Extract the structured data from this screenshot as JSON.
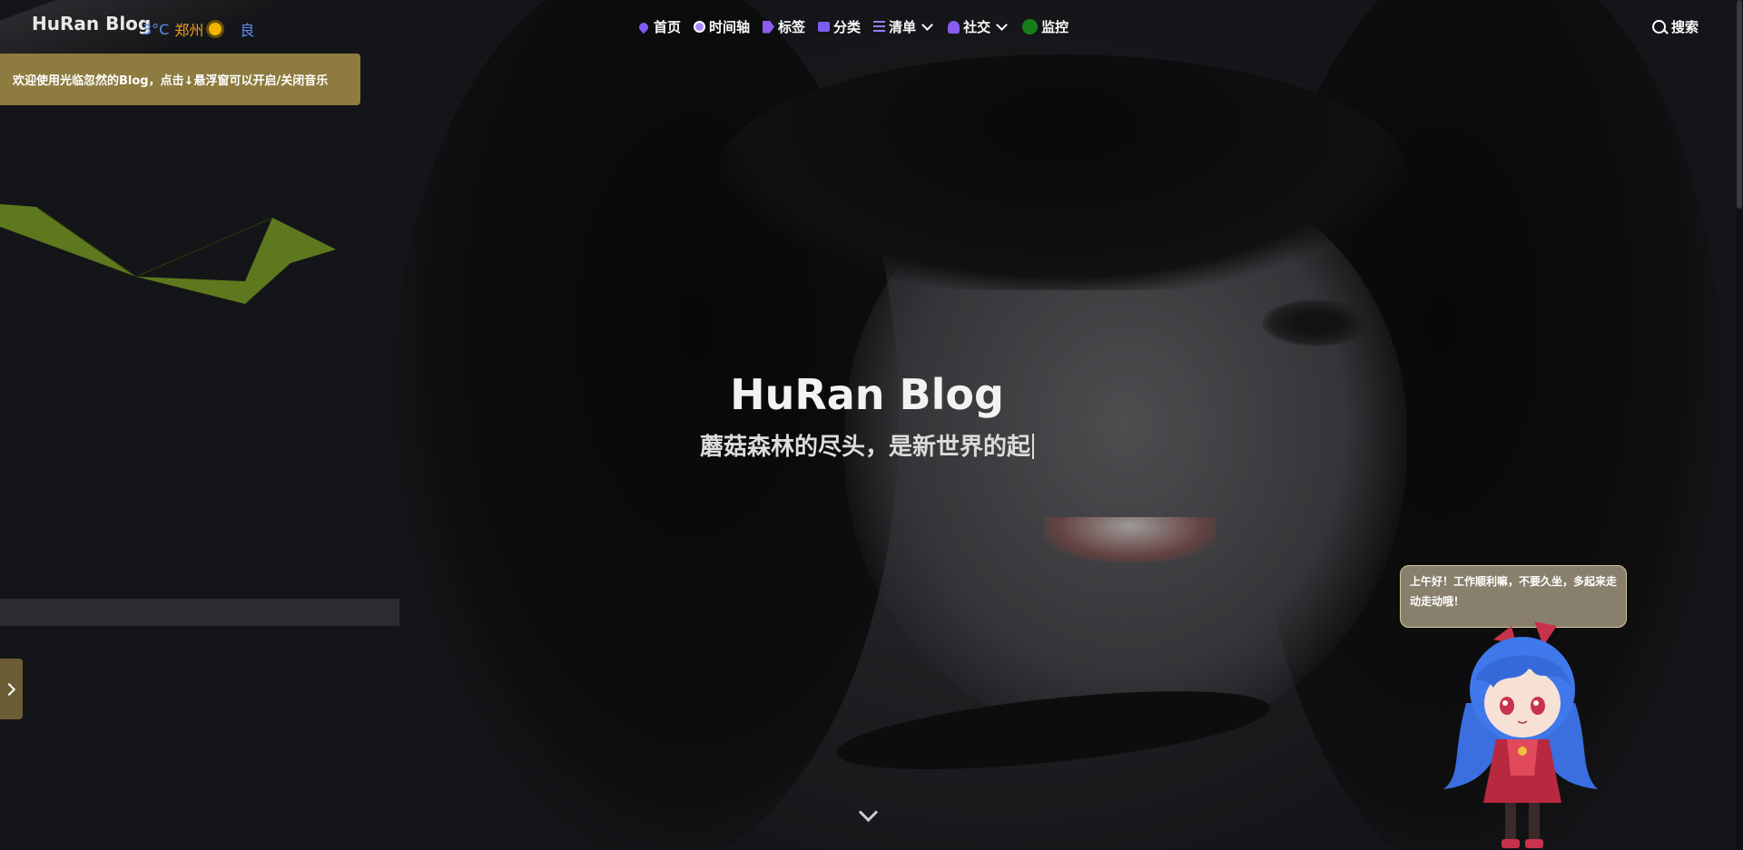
{
  "header": {
    "brand": "HuRan Blog",
    "weather": {
      "temp": "3°C",
      "city": "郑州",
      "aqi": "良"
    },
    "menu": [
      {
        "label": "首页",
        "icon": "home-icon"
      },
      {
        "label": "时间轴",
        "icon": "clock-icon"
      },
      {
        "label": "标签",
        "icon": "tag-icon"
      },
      {
        "label": "分类",
        "icon": "folder-icon"
      },
      {
        "label": "清单",
        "icon": "list-icon"
      },
      {
        "label": "社交",
        "icon": "user-icon"
      },
      {
        "label": "监控",
        "icon": "status-dot-icon"
      }
    ],
    "search_label": "搜索"
  },
  "toast": "欢迎使用光临忽然的Blog，点击↓悬浮窗可以开启/关闭音乐",
  "hero": {
    "title": "HuRan Blog",
    "subtitle": "蘑菇森林的尽头，是新世界的起"
  },
  "mascot": {
    "message": "上午好！工作顺利嘛，不要久坐，多起来走动走动哦！"
  },
  "colors": {
    "toast_bg": "#8d7b3f",
    "temp": "#5c8df0",
    "city": "#f0a020",
    "monitor_dot": "#15801a"
  }
}
